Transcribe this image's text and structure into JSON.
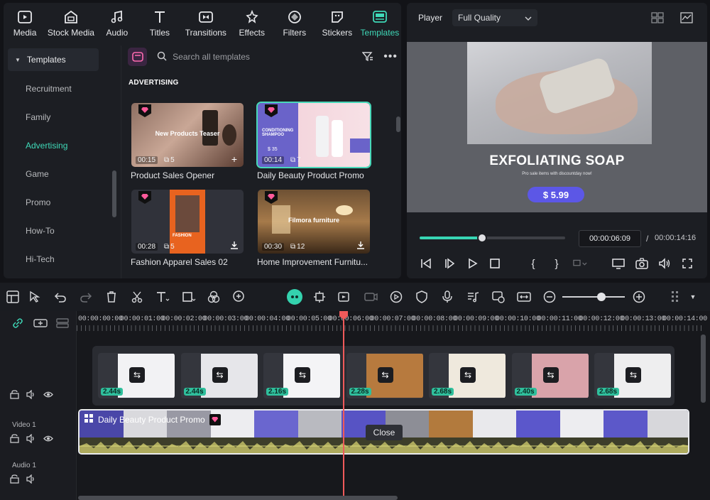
{
  "categories": [
    {
      "label": "Media",
      "icon": "media-icon"
    },
    {
      "label": "Stock Media",
      "icon": "stock-media-icon"
    },
    {
      "label": "Audio",
      "icon": "audio-icon"
    },
    {
      "label": "Titles",
      "icon": "titles-icon"
    },
    {
      "label": "Transitions",
      "icon": "transitions-icon"
    },
    {
      "label": "Effects",
      "icon": "effects-icon"
    },
    {
      "label": "Filters",
      "icon": "filters-icon"
    },
    {
      "label": "Stickers",
      "icon": "stickers-icon"
    },
    {
      "label": "Templates",
      "icon": "templates-icon",
      "active": true
    }
  ],
  "sidebar": {
    "header": "Templates",
    "items": [
      "Recruitment",
      "Family",
      "Advertising",
      "Game",
      "Promo",
      "How-To",
      "Hi-Tech"
    ],
    "active": "Advertising"
  },
  "search": {
    "placeholder": "Search all templates"
  },
  "section_title": "ADVERTISING",
  "templates": [
    {
      "title": "Product Sales Opener",
      "duration": "00:15",
      "count": "5",
      "overlay": "New Products Teaser",
      "action": "add"
    },
    {
      "title": "Daily Beauty Product Promo",
      "duration": "00:14",
      "count": "7",
      "overlay": "CONDITIONING SHAMPOO",
      "price": "$ 35",
      "action": "none",
      "selected": true
    },
    {
      "title": "Fashion Apparel Sales 02",
      "duration": "00:28",
      "count": "5",
      "overlay": "FASHION",
      "action": "download"
    },
    {
      "title": "Home Improvement Furnitu...",
      "duration": "00:30",
      "count": "12",
      "overlay": "Filmora furniture",
      "action": "download"
    }
  ],
  "player": {
    "label": "Player",
    "quality": "Full Quality",
    "headline": "EXFOLIATING SOAP",
    "subtext": "Pro sale items with discountday now!",
    "price": "$ 5.99",
    "current_time": "00:00:06:09",
    "separator": "/",
    "total_time": "00:00:14:16",
    "progress_fraction": 0.43
  },
  "timeline": {
    "ruler": [
      "00:00:00:00",
      "00:00:01:00",
      "00:00:02:00",
      "00:00:03:00",
      "00:00:04:00",
      "00:00:05:00",
      "00:00:06:00",
      "00:00:07:00",
      "00:00:08:00",
      "00:00:09:00",
      "00:00:10:00",
      "00:00:11:00",
      "00:00:12:00",
      "00:00:13:00",
      "00:00:14:00"
    ],
    "tracks": {
      "video": "Video 1",
      "audio": "Audio 1"
    },
    "composition_clips": [
      {
        "duration": "2.44s",
        "color": "#f2f2f4"
      },
      {
        "duration": "2.44s",
        "color": "#e6e6ea"
      },
      {
        "duration": "2.16s",
        "color": "#f4f4f6"
      },
      {
        "duration": "2.28s",
        "color": "#b77a3e"
      },
      {
        "duration": "2.68s",
        "color": "#efe9dd"
      },
      {
        "duration": "2.40s",
        "color": "#d9a3aa"
      },
      {
        "duration": "2.68s",
        "color": "#eeeeef"
      }
    ],
    "video_clip_title": "Daily Beauty Product Promo",
    "tooltip": "Close",
    "zoom_fraction": 0.63
  },
  "colors": {
    "accent": "#3fd9b8",
    "playhead": "#f05a5a",
    "price_pill": "#5c57e6"
  }
}
